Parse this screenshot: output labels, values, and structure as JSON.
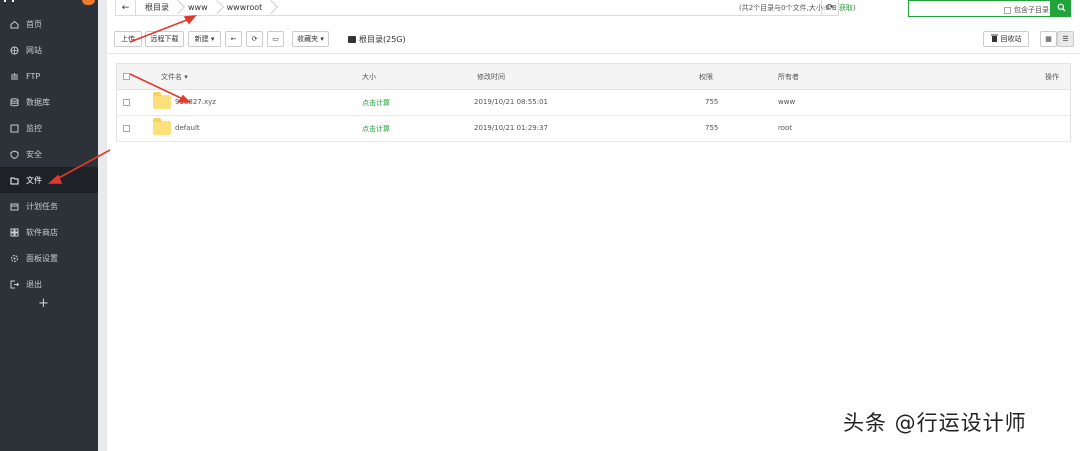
{
  "sidebar": {
    "items": [
      {
        "label": "首页",
        "icon": "home-icon",
        "active": false
      },
      {
        "label": "网站",
        "icon": "globe-icon",
        "active": false
      },
      {
        "label": "FTP",
        "icon": "ftp-icon",
        "active": false
      },
      {
        "label": "数据库",
        "icon": "database-icon",
        "active": false
      },
      {
        "label": "监控",
        "icon": "monitor-icon",
        "active": false
      },
      {
        "label": "安全",
        "icon": "shield-icon",
        "active": false
      },
      {
        "label": "文件",
        "icon": "folder-icon",
        "active": true
      },
      {
        "label": "计划任务",
        "icon": "calendar-icon",
        "active": false
      },
      {
        "label": "软件商店",
        "icon": "grid-icon",
        "active": false
      },
      {
        "label": "面板设置",
        "icon": "gear-icon",
        "active": false
      },
      {
        "label": "退出",
        "icon": "logout-icon",
        "active": false
      }
    ],
    "add_label": "+"
  },
  "pathbar": {
    "back_icon": "←",
    "crumbs": [
      "根目录",
      "www",
      "wwwroot"
    ],
    "refresh_icon": "⟳",
    "info": "(共2个目录与0个文件,大小:0 B ",
    "info_link": "获取",
    "info_end": ")"
  },
  "search": {
    "include_subdir_label": "包含子目录",
    "button_icon": "search-icon"
  },
  "toolbar": {
    "upload": "上传",
    "remote_download": "远程下载",
    "new": "新建 ▾",
    "back_icon": "←",
    "refresh_icon": "⟳",
    "terminal_icon": "▭",
    "favorites": "收藏夹 ▾",
    "disk": "根目录(25G)",
    "recycle": "回收站",
    "grid_view_icon": "▦",
    "list_view_icon": "☰"
  },
  "table": {
    "headers": {
      "name": "文件名",
      "size": "大小",
      "mtime": "修改时间",
      "perm": "权限",
      "owner": "所有者",
      "actions": "操作"
    },
    "rows": [
      {
        "name": "910827.xyz",
        "size": "点击计算",
        "mtime": "2019/10/21 08:55:01",
        "perm": "755",
        "owner": "www"
      },
      {
        "name": "default",
        "size": "点击计算",
        "mtime": "2019/10/21 01:29:37",
        "perm": "755",
        "owner": "root"
      }
    ]
  },
  "colors": {
    "accent": "#20a53a",
    "sidebar": "#2d3238",
    "annotation": "#e03a2e"
  },
  "watermark": "头条 @行运设计师"
}
